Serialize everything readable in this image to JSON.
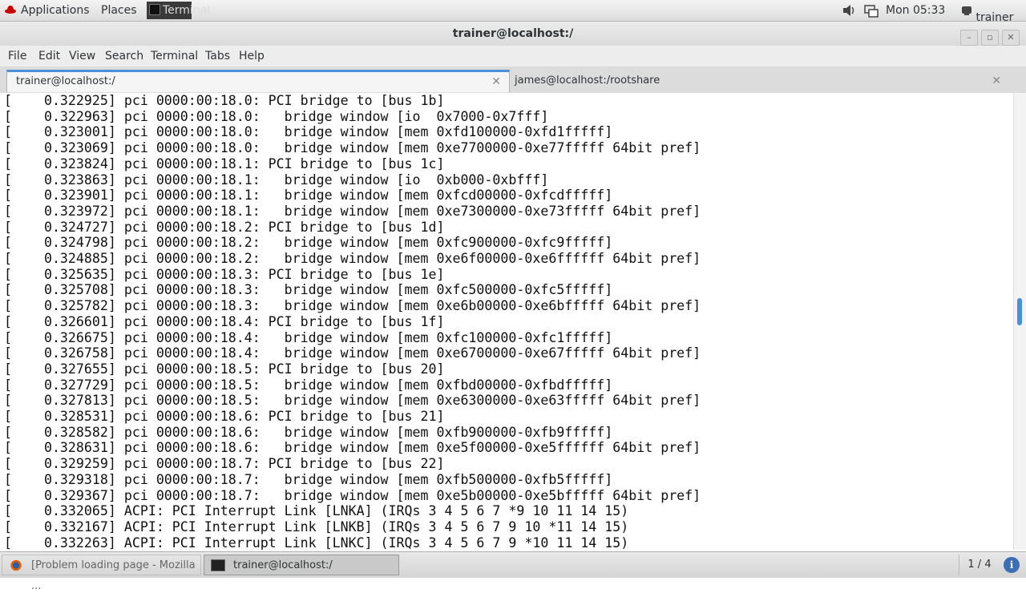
{
  "top_panel": {
    "applications": "Applications",
    "places": "Places",
    "terminal_task": "Terminal",
    "clock": "Mon 05:33",
    "user": "trainer"
  },
  "window": {
    "title": "trainer@localhost:/"
  },
  "menu": [
    "File",
    "Edit",
    "View",
    "Search",
    "Terminal",
    "Tabs",
    "Help"
  ],
  "tabs": [
    {
      "label": "trainer@localhost:/",
      "active": true
    },
    {
      "label": "james@localhost:/rootshare",
      "active": false
    }
  ],
  "terminal_lines": [
    "[    0.322925] pci 0000:00:18.0: PCI bridge to [bus 1b]",
    "[    0.322963] pci 0000:00:18.0:   bridge window [io  0x7000-0x7fff]",
    "[    0.323001] pci 0000:00:18.0:   bridge window [mem 0xfd100000-0xfd1fffff]",
    "[    0.323069] pci 0000:00:18.0:   bridge window [mem 0xe7700000-0xe77fffff 64bit pref]",
    "[    0.323824] pci 0000:00:18.1: PCI bridge to [bus 1c]",
    "[    0.323863] pci 0000:00:18.1:   bridge window [io  0xb000-0xbfff]",
    "[    0.323901] pci 0000:00:18.1:   bridge window [mem 0xfcd00000-0xfcdfffff]",
    "[    0.323972] pci 0000:00:18.1:   bridge window [mem 0xe7300000-0xe73fffff 64bit pref]",
    "[    0.324727] pci 0000:00:18.2: PCI bridge to [bus 1d]",
    "[    0.324798] pci 0000:00:18.2:   bridge window [mem 0xfc900000-0xfc9fffff]",
    "[    0.324885] pci 0000:00:18.2:   bridge window [mem 0xe6f00000-0xe6ffffff 64bit pref]",
    "[    0.325635] pci 0000:00:18.3: PCI bridge to [bus 1e]",
    "[    0.325708] pci 0000:00:18.3:   bridge window [mem 0xfc500000-0xfc5fffff]",
    "[    0.325782] pci 0000:00:18.3:   bridge window [mem 0xe6b00000-0xe6bfffff 64bit pref]",
    "[    0.326601] pci 0000:00:18.4: PCI bridge to [bus 1f]",
    "[    0.326675] pci 0000:00:18.4:   bridge window [mem 0xfc100000-0xfc1fffff]",
    "[    0.326758] pci 0000:00:18.4:   bridge window [mem 0xe6700000-0xe67fffff 64bit pref]",
    "[    0.327655] pci 0000:00:18.5: PCI bridge to [bus 20]",
    "[    0.327729] pci 0000:00:18.5:   bridge window [mem 0xfbd00000-0xfbdfffff]",
    "[    0.327813] pci 0000:00:18.5:   bridge window [mem 0xe6300000-0xe63fffff 64bit pref]",
    "[    0.328531] pci 0000:00:18.6: PCI bridge to [bus 21]",
    "[    0.328582] pci 0000:00:18.6:   bridge window [mem 0xfb900000-0xfb9fffff]",
    "[    0.328631] pci 0000:00:18.6:   bridge window [mem 0xe5f00000-0xe5ffffff 64bit pref]",
    "[    0.329259] pci 0000:00:18.7: PCI bridge to [bus 22]",
    "[    0.329318] pci 0000:00:18.7:   bridge window [mem 0xfb500000-0xfb5fffff]",
    "[    0.329367] pci 0000:00:18.7:   bridge window [mem 0xe5b00000-0xe5bfffff 64bit pref]",
    "[    0.332065] ACPI: PCI Interrupt Link [LNKA] (IRQs 3 4 5 6 7 *9 10 11 14 15)",
    "[    0.332167] ACPI: PCI Interrupt Link [LNKB] (IRQs 3 4 5 6 7 9 10 *11 14 15)",
    "[    0.332263] ACPI: PCI Interrupt Link [LNKC] (IRQs 3 4 5 6 7 9 *10 11 14 15)"
  ],
  "taskbar": {
    "tasks": [
      {
        "label": "[Problem loading page - Mozilla ..."
      },
      {
        "label": "trainer@localhost:/"
      }
    ],
    "workspace": "1 / 4"
  },
  "colors": {
    "accent": "#4a90d9",
    "redhat_red": "#cc0000"
  }
}
